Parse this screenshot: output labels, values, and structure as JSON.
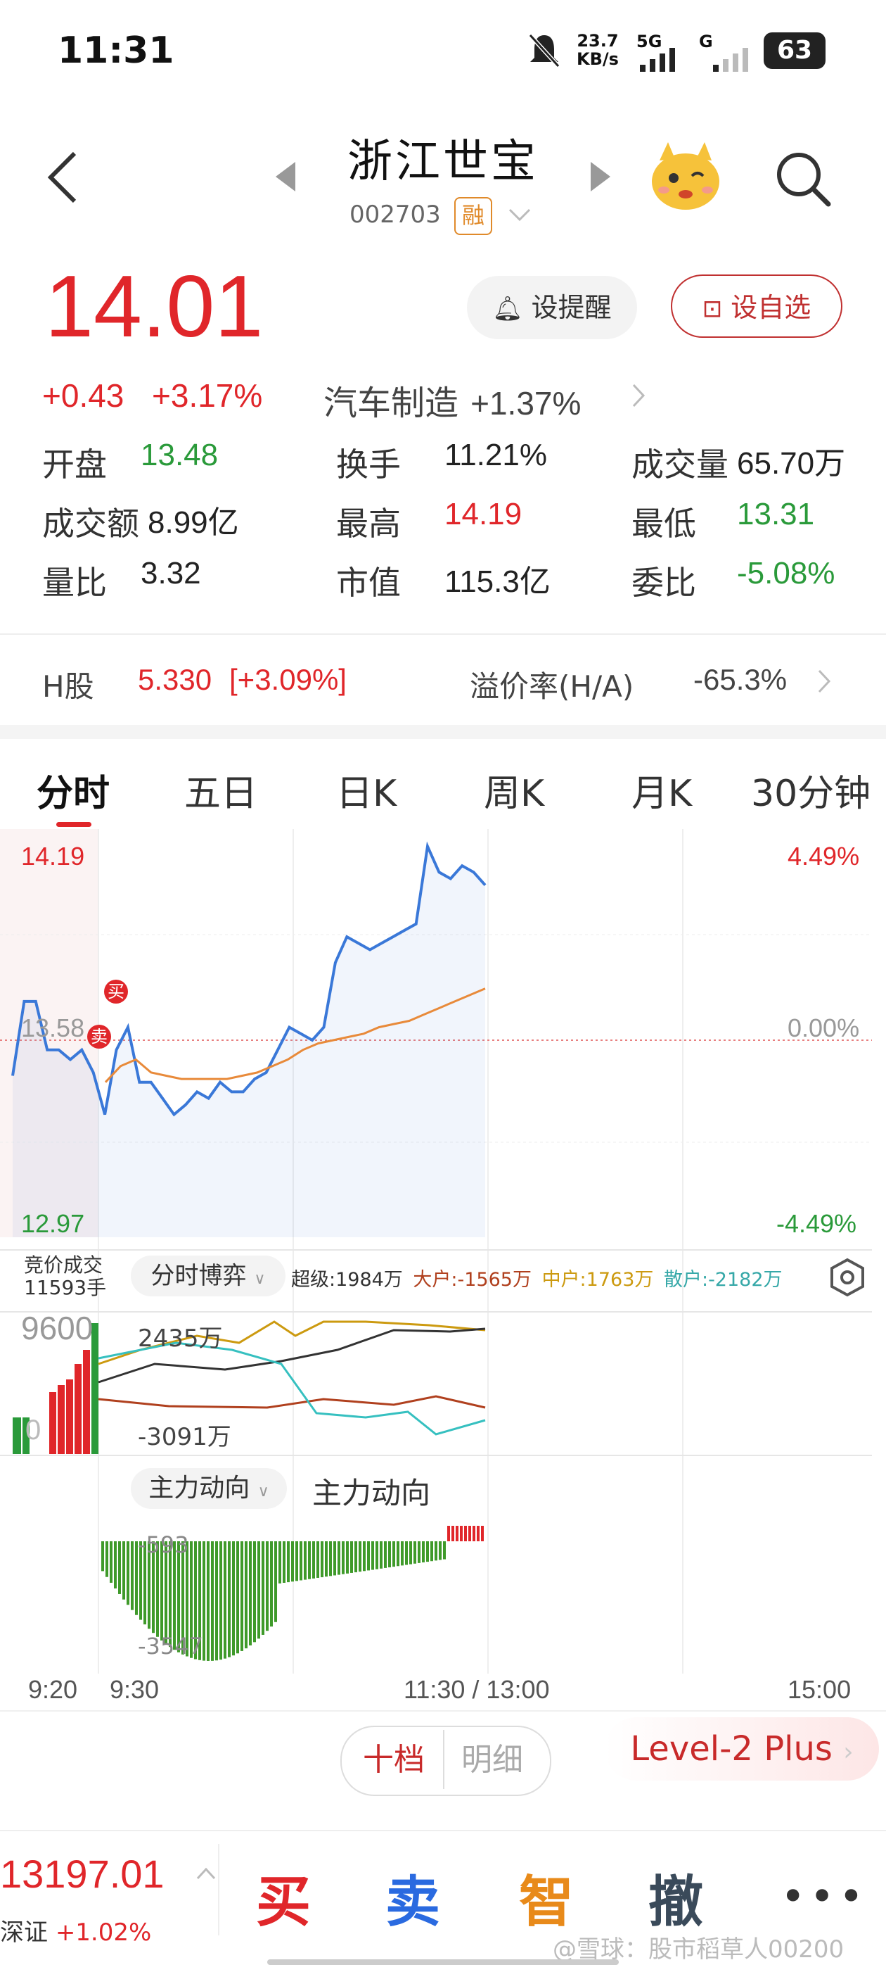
{
  "status": {
    "time": "11:31",
    "speed_top": "23.7",
    "speed_bottom": "KB/s",
    "network": "5G",
    "network2": "G",
    "battery": "63"
  },
  "header": {
    "title": "浙江世宝",
    "code": "002703",
    "badge": "融"
  },
  "quote": {
    "price": "14.01",
    "change": "+0.43",
    "change_pct": "+3.17%",
    "sector_name": "汽车制造",
    "sector_pct": "+1.37%",
    "remind_label": "设提醒",
    "watch_label": "设自选"
  },
  "stats": [
    [
      {
        "label": "开盘",
        "value": "13.48",
        "color": "green"
      },
      {
        "label": "换手",
        "value": "11.21%",
        "color": "dark"
      },
      {
        "label": "成交量",
        "value": "65.70万",
        "color": "dark"
      }
    ],
    [
      {
        "label": "成交额",
        "value": "8.99亿",
        "color": "dark"
      },
      {
        "label": "最高",
        "value": "14.19",
        "color": "red"
      },
      {
        "label": "最低",
        "value": "13.31",
        "color": "green"
      }
    ],
    [
      {
        "label": "量比",
        "value": "3.32",
        "color": "dark"
      },
      {
        "label": "市值",
        "value": "115.3亿",
        "color": "dark"
      },
      {
        "label": "委比",
        "value": "-5.08%",
        "color": "green"
      }
    ]
  ],
  "hshare": {
    "label": "H股",
    "price": "5.330",
    "pct": "[+3.09%]",
    "premium_label": "溢价率(H/A)",
    "premium_value": "-65.3%"
  },
  "tabs": [
    "分时",
    "五日",
    "日K",
    "周K",
    "月K",
    "30分钟"
  ],
  "chart_labels": {
    "high": "14.19",
    "mid": "13.58",
    "low": "12.97",
    "pct_high": "4.49%",
    "pct_mid": "0.00%",
    "pct_low": "-4.49%",
    "buy_marker": "买",
    "sell_marker": "卖"
  },
  "chart_data": {
    "type": "line",
    "ylim": [
      12.97,
      14.19
    ],
    "prev_close": 13.58,
    "x_range": "9:20–11:30 (morning session shown)",
    "series": [
      {
        "color": "#3a78d8",
        "values": [
          13.47,
          13.7,
          13.7,
          13.55,
          13.55,
          13.52,
          13.55,
          13.48,
          13.35,
          13.55,
          13.62,
          13.45,
          13.45,
          13.4,
          13.35,
          13.38,
          13.42,
          13.4,
          13.45,
          13.42,
          13.42,
          13.46,
          13.48,
          13.55,
          13.62,
          13.6,
          13.58,
          13.62,
          13.82,
          13.9,
          13.88,
          13.86,
          13.88,
          13.9,
          13.92,
          13.94,
          14.18,
          14.1,
          14.08,
          14.12,
          14.1,
          14.06
        ]
      },
      {
        "color": "#e88a3a",
        "values": [
          13.45,
          13.5,
          13.52,
          13.48,
          13.47,
          13.46,
          13.46,
          13.46,
          13.46,
          13.47,
          13.48,
          13.5,
          13.52,
          13.55,
          13.57,
          13.58,
          13.59,
          13.6,
          13.62,
          13.63,
          13.64,
          13.66,
          13.68,
          13.7,
          13.72,
          13.74
        ]
      }
    ]
  },
  "fund_bar": {
    "auction_label": "竞价成交",
    "auction_vol": "11593手",
    "selector": "分时博弈",
    "super": "超级:1984万",
    "big": "大户:-1565万",
    "mid": "中户:1763万",
    "retail": "散户:-2182万",
    "vol_top": "9600",
    "vol_zero": "0",
    "flow_top": "2435万",
    "flow_bottom": "-3091万"
  },
  "main_flow": {
    "selector": "主力动向",
    "title": "主力动向",
    "top": "-593",
    "bottom": "-3547"
  },
  "time_axis": [
    "9:20",
    "9:30",
    "11:30 / 13:00",
    "15:00"
  ],
  "order_tabs": {
    "tab1": "十档",
    "tab2": "明细",
    "level2": "Level-2 Plus"
  },
  "bottom_bar": {
    "index_value": "13197.01",
    "index_name": "深证",
    "index_pct": "+1.02%",
    "buy": "买",
    "sell": "卖",
    "smart": "智",
    "cancel": "撤",
    "watermark": "@雪球：股市稻草人00200"
  }
}
